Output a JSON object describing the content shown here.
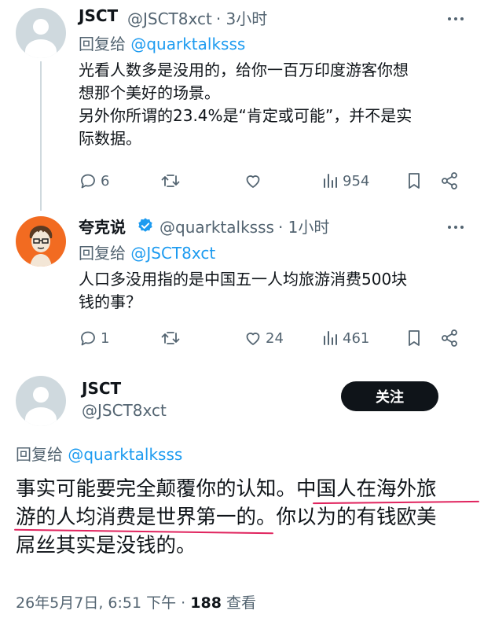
{
  "reply1": {
    "name": "JSCT",
    "handle": "@JSCT8xct",
    "time": "· 3小时",
    "reply_prefix": "回复给 ",
    "reply_to": "@quarktalksss",
    "lines": [
      "光看人数多是没用的，给你一百万印度游客你想",
      "想那个美好的场景。",
      "另外你所谓的23.4%是“肯定或可能”，并不是实",
      "际数据。"
    ],
    "stats": {
      "replies": "6",
      "likes": "",
      "views": "954"
    }
  },
  "reply2": {
    "name": "夸克说",
    "handle": "@quarktalksss",
    "time": "· 1小时",
    "verified": true,
    "reply_prefix": "回复给 ",
    "reply_to": "@JSCT8xct",
    "lines": [
      "人口多没用指的是中国五一人均旅游消费500块",
      "钱的事？"
    ],
    "stats": {
      "replies": "1",
      "likes": "24",
      "views": "461"
    }
  },
  "main": {
    "name": "JSCT",
    "handle": "@JSCT8xct",
    "follow_label": "关注",
    "reply_prefix": "回复给 ",
    "reply_to": "@quarktalksss",
    "lines": [
      "事实可能要完全颠覆你的认知。中国人在海外旅",
      "游的人均消费是世界第一的。你以为的有钱欧美",
      "屌丝其实是没钱的。"
    ],
    "date": "26年5月7日, 6:51 下午 · ",
    "views_count": "188",
    "views_label": " 查看"
  },
  "colors": {
    "accent": "#1d9bf0",
    "text": "#0f1419",
    "muted": "#536471",
    "underline": "#e0245e",
    "verified": "#1d9bf0",
    "avatar_orange": "#f26b21"
  },
  "icons": [
    "more-dots-icon",
    "reply-icon",
    "retweet-icon",
    "like-icon",
    "views-icon",
    "bookmark-icon",
    "share-icon",
    "verified-badge-icon",
    "default-avatar-icon",
    "cartoon-avatar"
  ]
}
